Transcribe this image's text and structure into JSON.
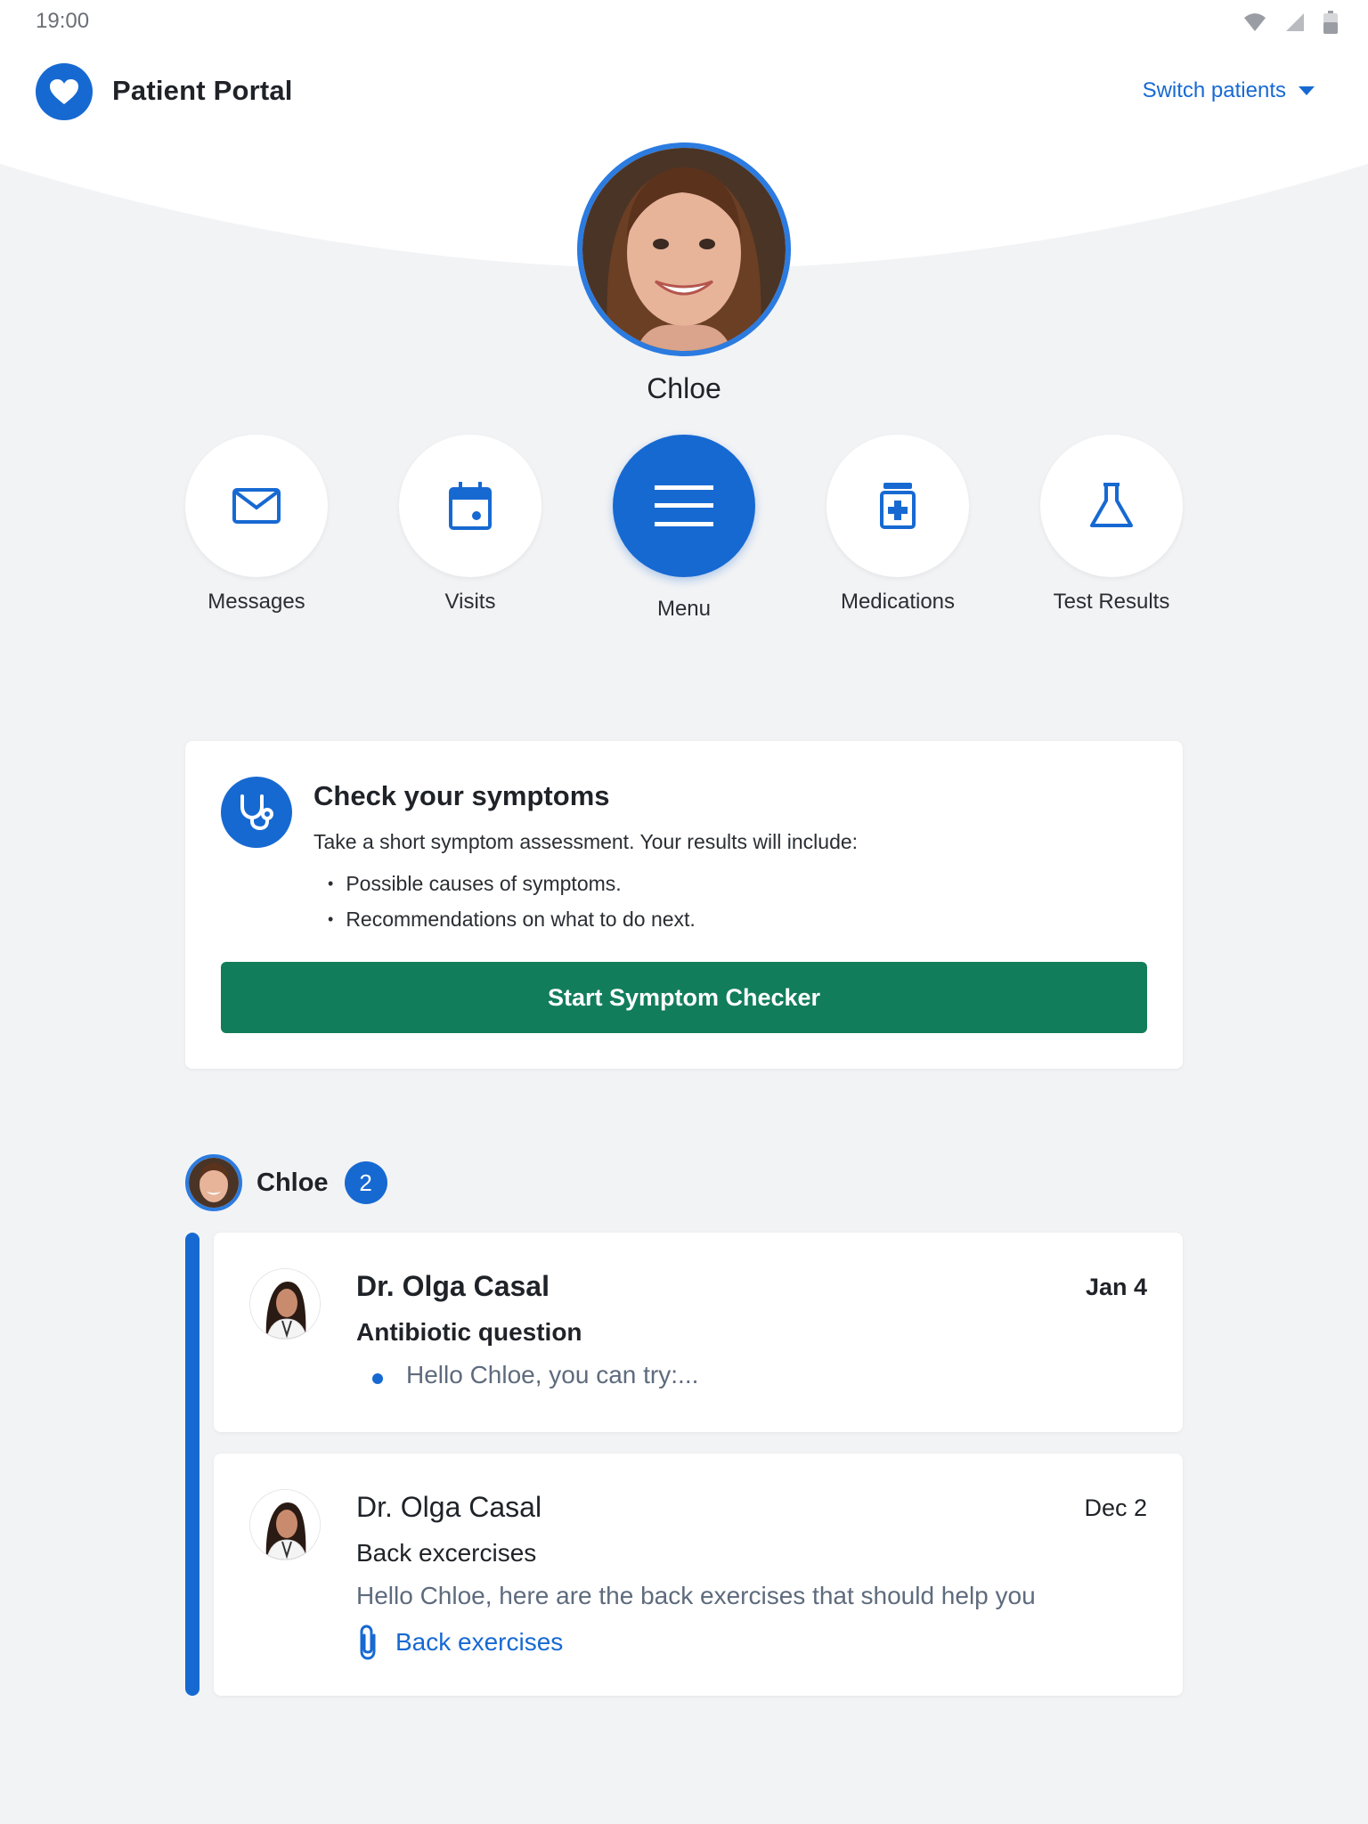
{
  "status_bar": {
    "time": "19:00"
  },
  "app_bar": {
    "title": "Patient Portal",
    "switch_label": "Switch patients"
  },
  "profile": {
    "name": "Chloe"
  },
  "actions": [
    {
      "label": "Messages",
      "icon": "envelope-icon"
    },
    {
      "label": "Visits",
      "icon": "calendar-icon"
    },
    {
      "label": "Menu",
      "icon": "hamburger-menu-icon"
    },
    {
      "label": "Medications",
      "icon": "medication-bottle-icon"
    },
    {
      "label": "Test Results",
      "icon": "flask-icon"
    }
  ],
  "symptom_card": {
    "title": "Check your symptoms",
    "description": "Take a short symptom assessment. Your results will include:",
    "bullets": [
      "Possible causes of symptoms.",
      "Recommendations on what to do next."
    ],
    "button_label": "Start Symptom Checker"
  },
  "conversation": {
    "name": "Chloe",
    "unread_count": "2",
    "messages": [
      {
        "from": "Dr. Olga Casal",
        "date": "Jan 4",
        "subject": "Antibiotic question",
        "preview": "Hello Chloe, you can try:...",
        "unread": true
      },
      {
        "from": "Dr. Olga Casal",
        "date": "Dec 2",
        "subject": "Back excercises",
        "preview": "Hello Chloe, here are the back exercises  that should help you",
        "attachment": "Back exercises",
        "unread": false
      }
    ]
  },
  "colors": {
    "primary": "#1769d2",
    "accent_green": "#127d5a",
    "background": "#f2f3f5"
  }
}
